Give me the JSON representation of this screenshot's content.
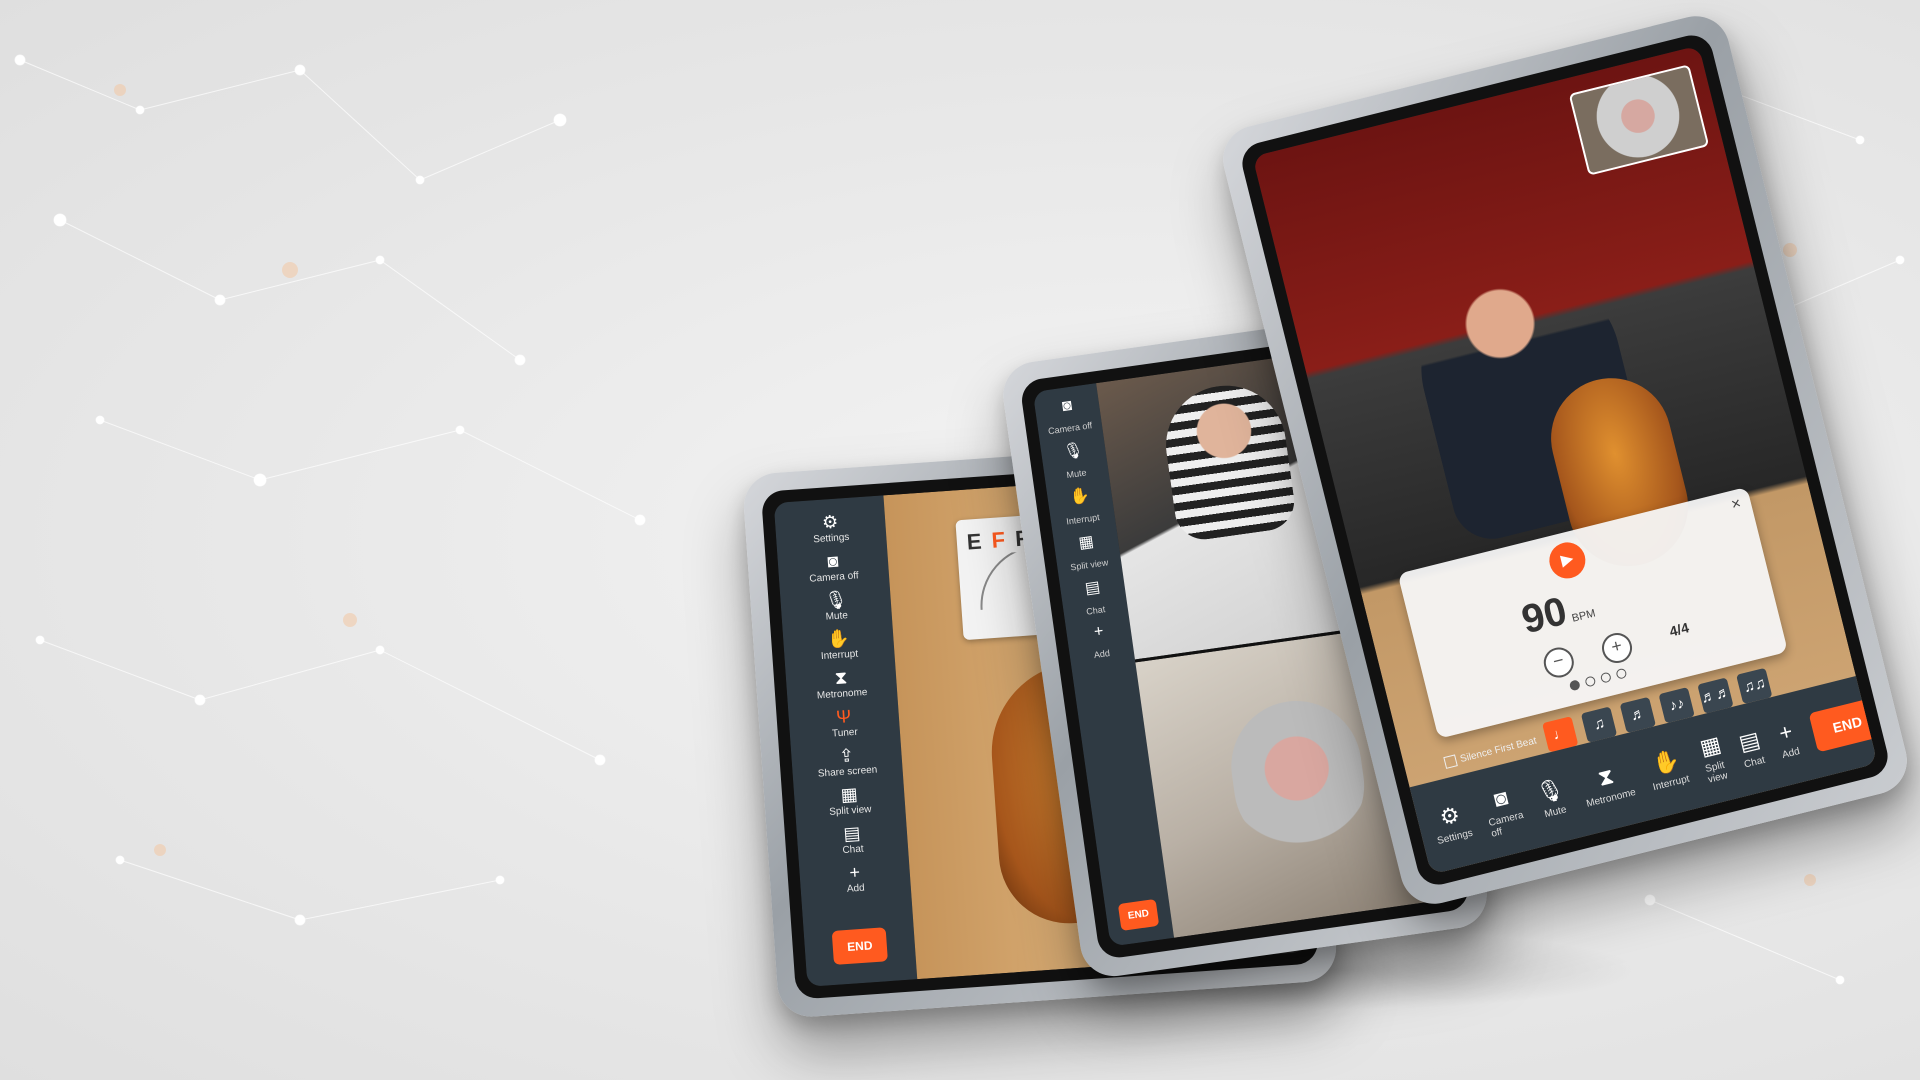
{
  "tablet_a": {
    "sidebar": [
      {
        "label": "Settings",
        "icon": "gear-icon",
        "glyph": "⚙"
      },
      {
        "label": "Camera off",
        "icon": "camera-icon",
        "glyph": "◙"
      },
      {
        "label": "Mute",
        "icon": "microphone-icon",
        "glyph": "🎙"
      },
      {
        "label": "Interrupt",
        "icon": "hand-icon",
        "glyph": "✋"
      },
      {
        "label": "Metronome",
        "icon": "metronome-icon",
        "glyph": "⧗"
      },
      {
        "label": "Tuner",
        "icon": "tuning-fork-icon",
        "glyph": "Ψ"
      },
      {
        "label": "Share screen",
        "icon": "share-screen-icon",
        "glyph": "⇪"
      },
      {
        "label": "Split view",
        "icon": "split-view-icon",
        "glyph": "▦"
      },
      {
        "label": "Chat",
        "icon": "chat-icon",
        "glyph": "▤"
      },
      {
        "label": "Add",
        "icon": "add-person-icon",
        "glyph": "+"
      }
    ],
    "end_label": "END",
    "tuner": {
      "notes_left": "E",
      "note_highlight": "F",
      "notes_right": "F"
    }
  },
  "tablet_b": {
    "sidebar": [
      {
        "label": "Camera off",
        "icon": "camera-icon",
        "glyph": "◙"
      },
      {
        "label": "Mute",
        "icon": "microphone-icon",
        "glyph": "🎙"
      },
      {
        "label": "Interrupt",
        "icon": "hand-icon",
        "glyph": "✋"
      },
      {
        "label": "Split view",
        "icon": "split-view-icon",
        "glyph": "▦"
      },
      {
        "label": "Chat",
        "icon": "chat-icon",
        "glyph": "▤"
      },
      {
        "label": "Add",
        "icon": "add-person-icon",
        "glyph": "+"
      }
    ],
    "end_label": "END"
  },
  "tablet_c": {
    "metronome": {
      "bpm": "90",
      "bpm_unit": "BPM",
      "time_signature": "4/4",
      "close": "×",
      "play": "▶"
    },
    "rhythm": {
      "checkbox_label": "Silence First Beat",
      "buttons": [
        "♩",
        "♫",
        "♬",
        "♪♪",
        "♬♬",
        "♫♫"
      ]
    },
    "bottom_bar": [
      {
        "label": "Settings",
        "icon": "gear-icon",
        "glyph": "⚙"
      },
      {
        "label": "Camera off",
        "icon": "camera-icon",
        "glyph": "◙"
      },
      {
        "label": "Mute",
        "icon": "microphone-icon",
        "glyph": "🎙"
      },
      {
        "label": "Metronome",
        "icon": "metronome-icon",
        "glyph": "⧗"
      },
      {
        "label": "Interrupt",
        "icon": "hand-icon",
        "glyph": "✋"
      },
      {
        "label": "Split view",
        "icon": "split-view-icon",
        "glyph": "▦"
      },
      {
        "label": "Chat",
        "icon": "chat-icon",
        "glyph": "▤"
      },
      {
        "label": "Add",
        "icon": "add-person-icon",
        "glyph": "+"
      }
    ],
    "end_label": "END"
  },
  "colors": {
    "accent": "#ff5a1f",
    "toolbar": "#2f3a43"
  }
}
